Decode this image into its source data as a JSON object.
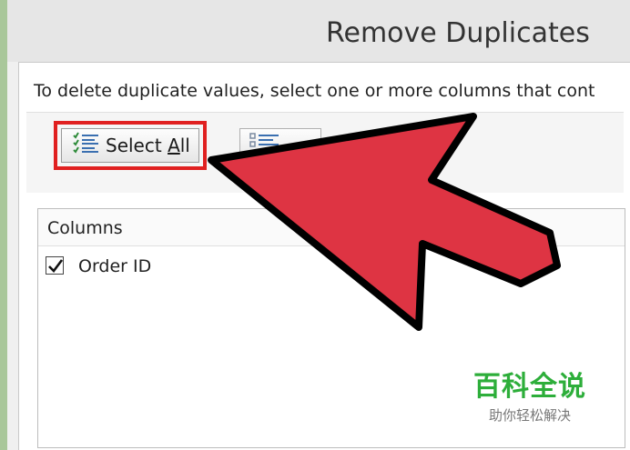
{
  "dialog": {
    "title": "Remove Duplicates",
    "instruction": "To delete duplicate values, select one or more columns that cont"
  },
  "toolbar": {
    "select_all_label_prefix": "Select ",
    "select_all_label_hotkey": "A",
    "select_all_label_suffix": "ll",
    "select_all_icon": "checklist-icon",
    "unselect_all_icon": "list-icon"
  },
  "columns": {
    "header": "Columns",
    "items": [
      {
        "label": "Order ID",
        "checked": true
      }
    ]
  },
  "watermark": {
    "main": "百科全说",
    "sub": "助你轻松解决"
  },
  "colors": {
    "highlight": "#e02020",
    "arrow_fill": "#de3443",
    "watermark": "#2dae3a",
    "frame": "#a9c79a"
  }
}
